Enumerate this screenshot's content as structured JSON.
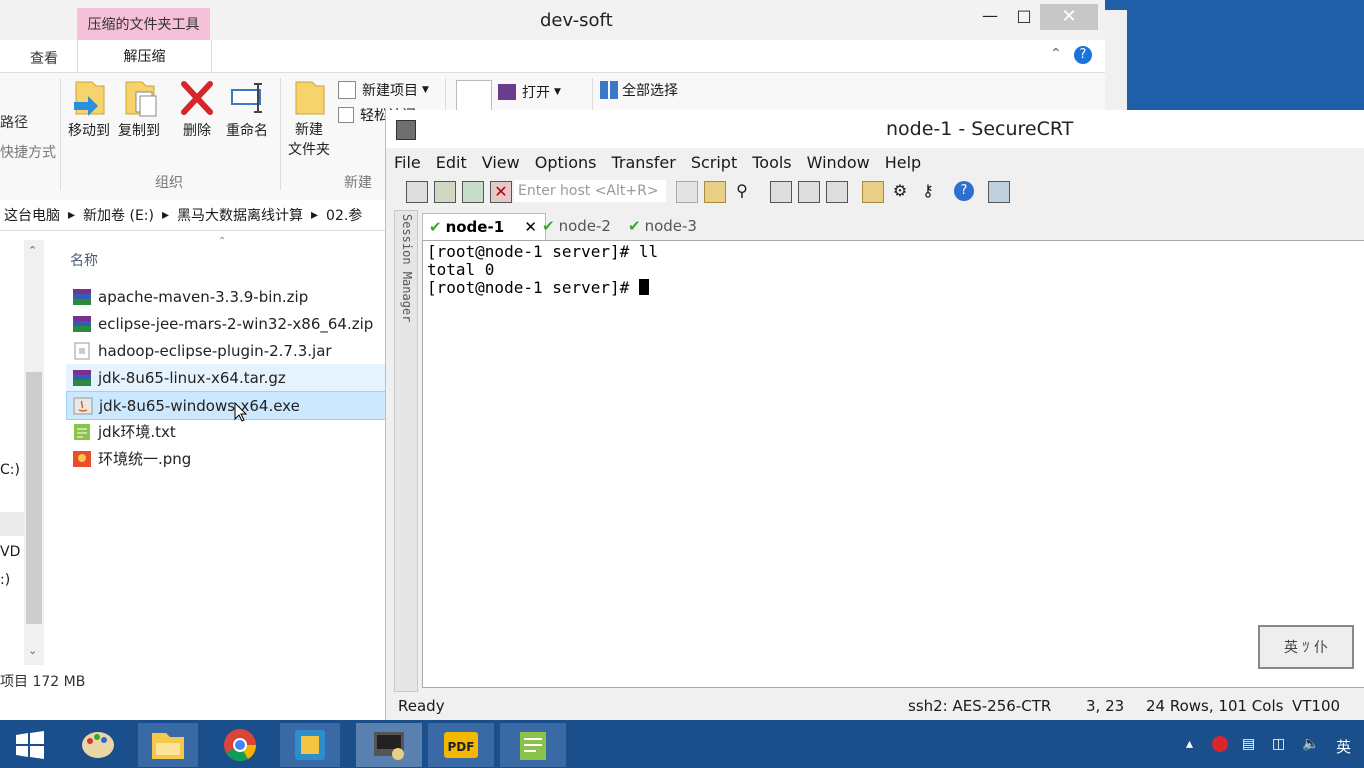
{
  "explorer": {
    "title": "dev-soft",
    "context_tab_title": "压缩的文件夹工具",
    "ribbon_tabs": [
      "查看",
      "解压缩"
    ],
    "active_ribbon_tab": "解压缩",
    "ribbon_left_cut": [
      "路径",
      "快捷方式"
    ],
    "ribbon_buttons": {
      "move_to": "移动到",
      "copy_to": "复制到",
      "delete": "删除",
      "rename": "重命名",
      "new_folder": "新建\n文件夹",
      "new_item": "新建项目",
      "easy_access": "轻松访问",
      "open": "打开",
      "select_all": "全部选择"
    },
    "group_labels": [
      "组织",
      "新建"
    ],
    "breadcrumb": [
      "这台电脑",
      "新加卷 (E:)",
      "黑马大数据离线计算",
      "02.参"
    ],
    "column_header": "名称",
    "nav_cut": [
      "C:)",
      "VD U",
      ":)"
    ],
    "files": [
      {
        "name": "apache-maven-3.3.9-bin.zip",
        "icon": "winrar-archive-icon",
        "state": "normal"
      },
      {
        "name": "eclipse-jee-mars-2-win32-x86_64.zip",
        "icon": "winrar-archive-icon",
        "state": "normal"
      },
      {
        "name": "hadoop-eclipse-plugin-2.7.3.jar",
        "icon": "jar-file-icon",
        "state": "normal"
      },
      {
        "name": "jdk-8u65-linux-x64.tar.gz",
        "icon": "winrar-archive-icon",
        "state": "hover"
      },
      {
        "name": "jdk-8u65-windows-x64.exe",
        "icon": "java-installer-icon",
        "state": "selected"
      },
      {
        "name": "jdk环境.txt",
        "icon": "text-file-icon",
        "state": "normal"
      },
      {
        "name": "环境统一.png",
        "icon": "image-file-icon",
        "state": "normal"
      }
    ],
    "status_text": "项目  172 MB"
  },
  "securecrt": {
    "title": "node-1 - SecureCRT",
    "menu": [
      "File",
      "Edit",
      "View",
      "Options",
      "Transfer",
      "Script",
      "Tools",
      "Window",
      "Help"
    ],
    "host_placeholder": "Enter host <Alt+R>",
    "session_manager_label": "Session Manager",
    "tabs": [
      {
        "label": "node-1",
        "active": true
      },
      {
        "label": "node-2",
        "active": false
      },
      {
        "label": "node-3",
        "active": false
      }
    ],
    "terminal_lines": [
      "[root@node-1 server]# ll",
      "total 0",
      "[root@node-1 server]# "
    ],
    "status": {
      "ready": "Ready",
      "cipher": "ssh2: AES-256-CTR",
      "cursor_pos": "3,  23",
      "size": "24 Rows, 101 Cols",
      "emulation": "VT100"
    },
    "ime_stamp": "英 ﾂ 仆"
  },
  "taskbar": {
    "items": [
      "start-button",
      "paint-icon",
      "file-explorer-icon",
      "chrome-icon",
      "folder-app-icon",
      "securecrt-icon",
      "pdf-icon",
      "notepad-icon"
    ],
    "tray_lang": "英"
  },
  "colors": {
    "desktop": "#1e5fa8",
    "taskbar": "#1a4f8c",
    "context_tab": "#f5c0d8",
    "selection": "#cce8ff"
  }
}
